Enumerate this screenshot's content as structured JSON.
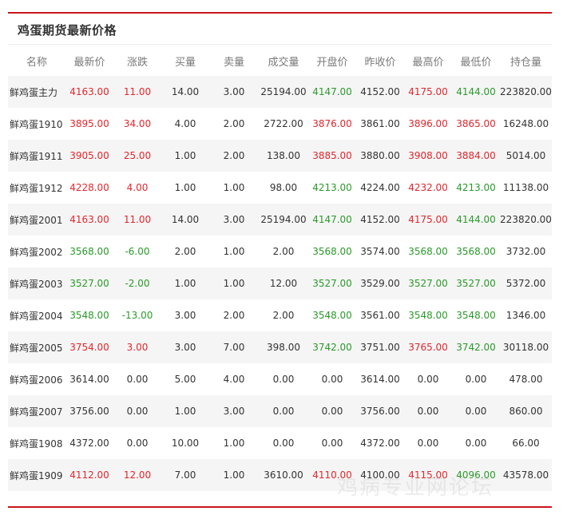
{
  "title": "鸡蛋期货最新价格",
  "colors": {
    "up": "#e3262c",
    "down": "#2a9a2a",
    "accent": "#c8161d"
  },
  "columns": [
    "名称",
    "最新价",
    "涨跌",
    "买量",
    "卖量",
    "成交量",
    "开盘价",
    "昨收价",
    "最高价",
    "最低价",
    "持仓量"
  ],
  "rows": [
    {
      "cells": [
        "鲜鸡蛋主力",
        "4163.00",
        "11.00",
        "14.00",
        "3.00",
        "25194.00",
        "4147.00",
        "4152.00",
        "4175.00",
        "4144.00",
        "223820.00"
      ],
      "tones": [
        "flat",
        "up",
        "up",
        "flat",
        "flat",
        "flat",
        "down",
        "flat",
        "up",
        "down",
        "flat"
      ]
    },
    {
      "cells": [
        "鲜鸡蛋1910",
        "3895.00",
        "34.00",
        "4.00",
        "2.00",
        "2722.00",
        "3876.00",
        "3861.00",
        "3896.00",
        "3865.00",
        "16248.00"
      ],
      "tones": [
        "flat",
        "up",
        "up",
        "flat",
        "flat",
        "flat",
        "up",
        "flat",
        "up",
        "up",
        "flat"
      ]
    },
    {
      "cells": [
        "鲜鸡蛋1911",
        "3905.00",
        "25.00",
        "1.00",
        "2.00",
        "138.00",
        "3885.00",
        "3880.00",
        "3908.00",
        "3884.00",
        "5014.00"
      ],
      "tones": [
        "flat",
        "up",
        "up",
        "flat",
        "flat",
        "flat",
        "up",
        "flat",
        "up",
        "up",
        "flat"
      ]
    },
    {
      "cells": [
        "鲜鸡蛋1912",
        "4228.00",
        "4.00",
        "1.00",
        "1.00",
        "98.00",
        "4213.00",
        "4224.00",
        "4232.00",
        "4213.00",
        "11138.00"
      ],
      "tones": [
        "flat",
        "up",
        "up",
        "flat",
        "flat",
        "flat",
        "down",
        "flat",
        "up",
        "down",
        "flat"
      ]
    },
    {
      "cells": [
        "鲜鸡蛋2001",
        "4163.00",
        "11.00",
        "14.00",
        "3.00",
        "25194.00",
        "4147.00",
        "4152.00",
        "4175.00",
        "4144.00",
        "223820.00"
      ],
      "tones": [
        "flat",
        "up",
        "up",
        "flat",
        "flat",
        "flat",
        "down",
        "flat",
        "up",
        "down",
        "flat"
      ]
    },
    {
      "cells": [
        "鲜鸡蛋2002",
        "3568.00",
        "-6.00",
        "2.00",
        "1.00",
        "2.00",
        "3568.00",
        "3574.00",
        "3568.00",
        "3568.00",
        "3732.00"
      ],
      "tones": [
        "flat",
        "down",
        "down",
        "flat",
        "flat",
        "flat",
        "down",
        "flat",
        "down",
        "down",
        "flat"
      ]
    },
    {
      "cells": [
        "鲜鸡蛋2003",
        "3527.00",
        "-2.00",
        "1.00",
        "1.00",
        "12.00",
        "3527.00",
        "3529.00",
        "3527.00",
        "3527.00",
        "5372.00"
      ],
      "tones": [
        "flat",
        "down",
        "down",
        "flat",
        "flat",
        "flat",
        "down",
        "flat",
        "down",
        "down",
        "flat"
      ]
    },
    {
      "cells": [
        "鲜鸡蛋2004",
        "3548.00",
        "-13.00",
        "3.00",
        "2.00",
        "2.00",
        "3548.00",
        "3561.00",
        "3548.00",
        "3548.00",
        "1346.00"
      ],
      "tones": [
        "flat",
        "down",
        "down",
        "flat",
        "flat",
        "flat",
        "down",
        "flat",
        "down",
        "down",
        "flat"
      ]
    },
    {
      "cells": [
        "鲜鸡蛋2005",
        "3754.00",
        "3.00",
        "3.00",
        "7.00",
        "398.00",
        "3742.00",
        "3751.00",
        "3765.00",
        "3742.00",
        "30118.00"
      ],
      "tones": [
        "flat",
        "up",
        "up",
        "flat",
        "flat",
        "flat",
        "down",
        "flat",
        "up",
        "down",
        "flat"
      ]
    },
    {
      "cells": [
        "鲜鸡蛋2006",
        "3614.00",
        "0.00",
        "5.00",
        "4.00",
        "0.00",
        "0.00",
        "3614.00",
        "0.00",
        "0.00",
        "478.00"
      ],
      "tones": [
        "flat",
        "flat",
        "flat",
        "flat",
        "flat",
        "flat",
        "flat",
        "flat",
        "flat",
        "flat",
        "flat"
      ]
    },
    {
      "cells": [
        "鲜鸡蛋2007",
        "3756.00",
        "0.00",
        "1.00",
        "3.00",
        "0.00",
        "0.00",
        "3756.00",
        "0.00",
        "0.00",
        "860.00"
      ],
      "tones": [
        "flat",
        "flat",
        "flat",
        "flat",
        "flat",
        "flat",
        "flat",
        "flat",
        "flat",
        "flat",
        "flat"
      ]
    },
    {
      "cells": [
        "鲜鸡蛋1908",
        "4372.00",
        "0.00",
        "10.00",
        "1.00",
        "0.00",
        "0.00",
        "4372.00",
        "0.00",
        "0.00",
        "66.00"
      ],
      "tones": [
        "flat",
        "flat",
        "flat",
        "flat",
        "flat",
        "flat",
        "flat",
        "flat",
        "flat",
        "flat",
        "flat"
      ]
    },
    {
      "cells": [
        "鲜鸡蛋1909",
        "4112.00",
        "12.00",
        "7.00",
        "1.00",
        "3610.00",
        "4110.00",
        "4100.00",
        "4115.00",
        "4096.00",
        "43578.00"
      ],
      "tones": [
        "flat",
        "up",
        "up",
        "flat",
        "flat",
        "flat",
        "up",
        "flat",
        "up",
        "down",
        "flat"
      ]
    }
  ],
  "watermark": "鸡病专业网论坛"
}
